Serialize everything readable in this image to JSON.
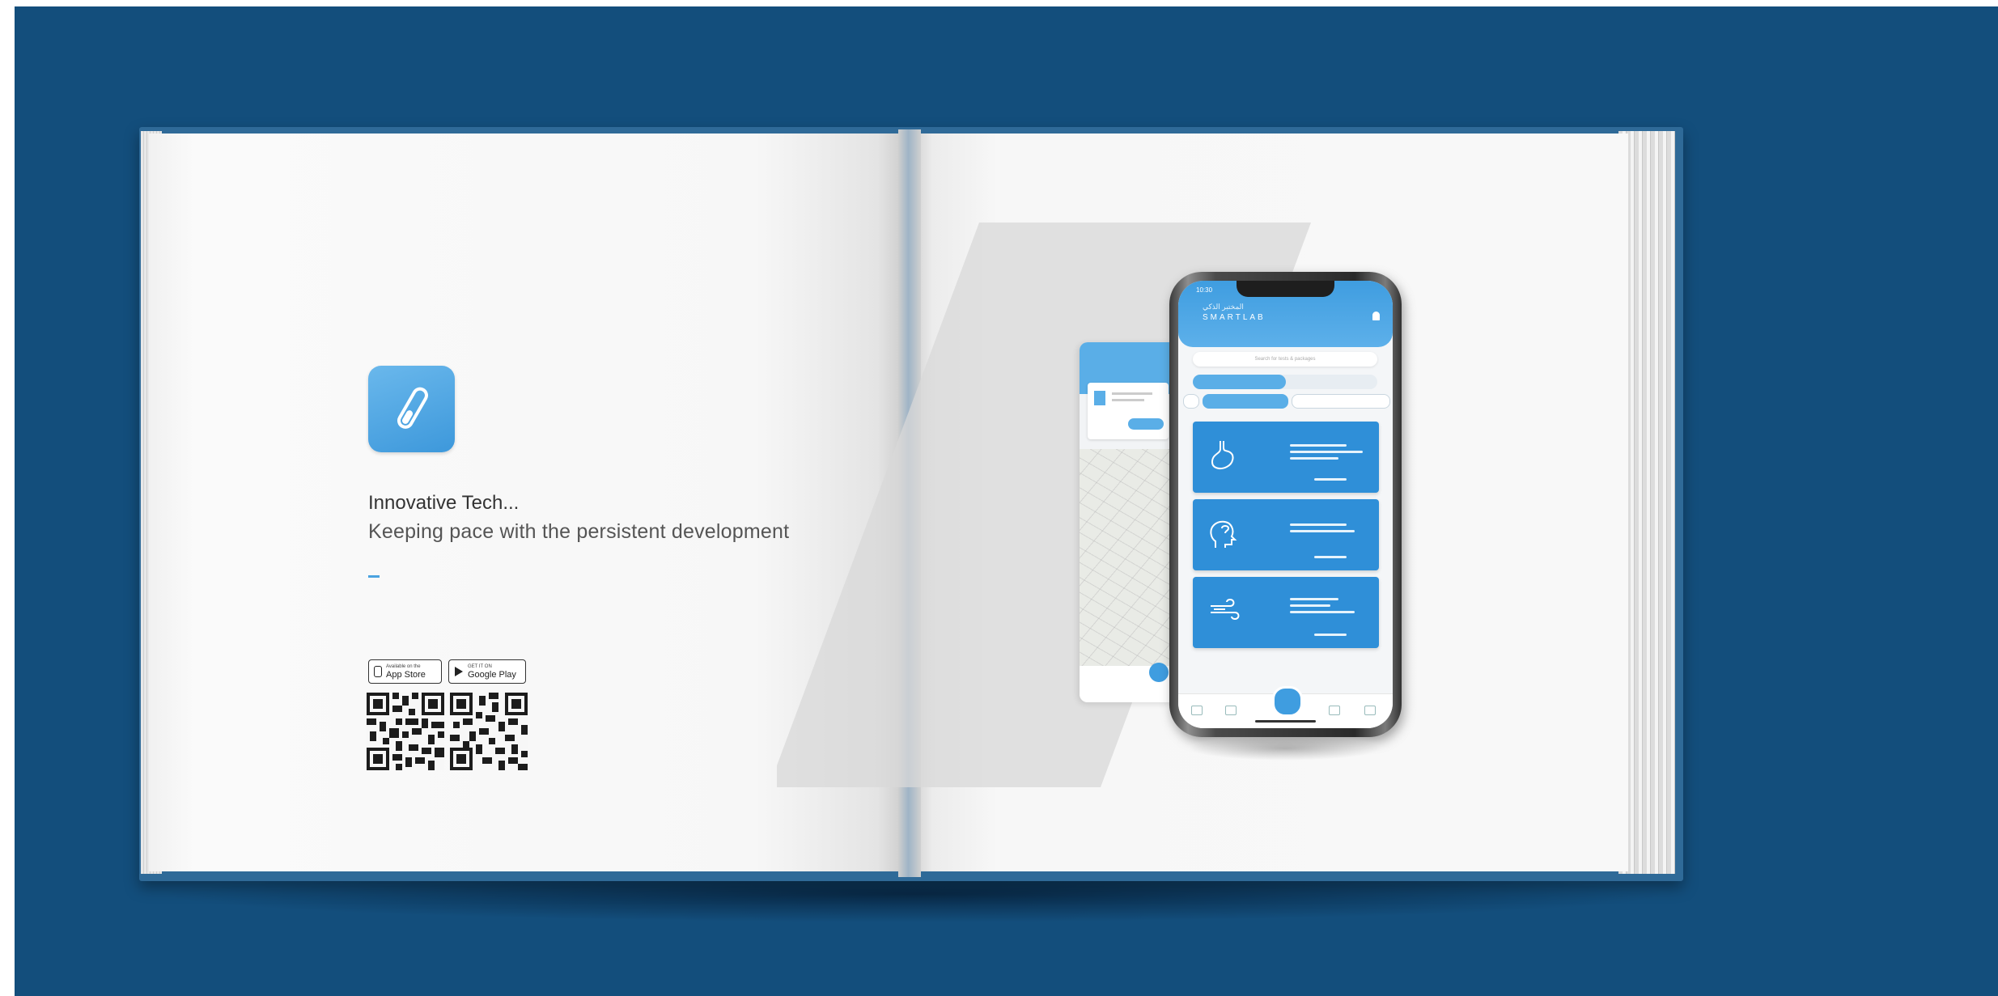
{
  "left_page": {
    "heading": "Innovative Tech...",
    "subheading": "Keeping pace with the persistent development",
    "app_icon": "test-tube-icon",
    "store_badges": [
      {
        "small": "Available on the",
        "big": "App Store",
        "icon": "apple-icon"
      },
      {
        "small": "GET IT ON",
        "big": "Google Play",
        "icon": "play-icon"
      }
    ],
    "qr_codes": [
      "qr-code-app-store",
      "qr-code-google-play"
    ]
  },
  "right_page": {
    "phone": {
      "status_time": "10:30",
      "brand_line1": "المختبر الذكي",
      "brand_line2": "SMARTLAB",
      "search_placeholder": "Search for tests & packages",
      "cards": [
        {
          "icon": "stomach-icon"
        },
        {
          "icon": "head-question-icon"
        },
        {
          "icon": "wind-icon"
        }
      ]
    }
  },
  "colors": {
    "background": "#134e7c",
    "accent": "#3f9de0",
    "card": "#2f8fd8"
  }
}
